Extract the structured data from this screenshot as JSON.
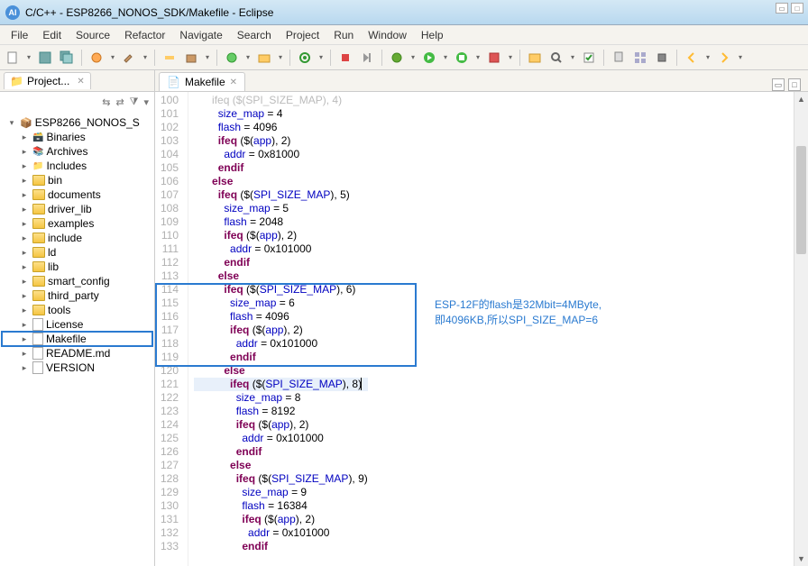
{
  "window": {
    "title": "C/C++ - ESP8266_NONOS_SDK/Makefile - Eclipse"
  },
  "menu": {
    "items": [
      "File",
      "Edit",
      "Source",
      "Refactor",
      "Navigate",
      "Search",
      "Project",
      "Run",
      "Window",
      "Help"
    ]
  },
  "sidebar": {
    "tab_label": "Project...",
    "root": "ESP8266_NONOS_S",
    "items": [
      {
        "label": "Binaries"
      },
      {
        "label": "Archives"
      },
      {
        "label": "Includes"
      },
      {
        "label": "bin"
      },
      {
        "label": "documents"
      },
      {
        "label": "driver_lib"
      },
      {
        "label": "examples"
      },
      {
        "label": "include"
      },
      {
        "label": "ld"
      },
      {
        "label": "lib"
      },
      {
        "label": "smart_config"
      },
      {
        "label": "third_party"
      },
      {
        "label": "tools"
      },
      {
        "label": "License"
      },
      {
        "label": "Makefile"
      },
      {
        "label": "README.md"
      },
      {
        "label": "VERSION"
      }
    ]
  },
  "editor": {
    "tab_label": "Makefile",
    "lines": [
      {
        "n": 100,
        "ind": 3,
        "raw": "ifeq ($(SPI_SIZE_MAP), 4)",
        "faded": true
      },
      {
        "n": 101,
        "ind": 4,
        "html": "<span class='var'>size_map</span> = 4"
      },
      {
        "n": 102,
        "ind": 4,
        "html": "<span class='var'>flash</span> = 4096"
      },
      {
        "n": 103,
        "ind": 4,
        "html": "<span class='kw'>ifeq</span> ($(<span class='var'>app</span>), 2)"
      },
      {
        "n": 104,
        "ind": 5,
        "html": "<span class='var'>addr</span> = 0x81000"
      },
      {
        "n": 105,
        "ind": 4,
        "html": "<span class='kw'>endif</span>"
      },
      {
        "n": 106,
        "ind": 3,
        "html": "<span class='kw'>else</span>"
      },
      {
        "n": 107,
        "ind": 4,
        "html": "<span class='kw'>ifeq</span> ($(<span class='var'>SPI_SIZE_MAP</span>), 5)"
      },
      {
        "n": 108,
        "ind": 5,
        "html": "<span class='var'>size_map</span> = 5"
      },
      {
        "n": 109,
        "ind": 5,
        "html": "<span class='var'>flash</span> = 2048"
      },
      {
        "n": 110,
        "ind": 5,
        "html": "<span class='kw'>ifeq</span> ($(<span class='var'>app</span>), 2)"
      },
      {
        "n": 111,
        "ind": 6,
        "html": "<span class='var'>addr</span> = 0x101000"
      },
      {
        "n": 112,
        "ind": 5,
        "html": "<span class='kw'>endif</span>"
      },
      {
        "n": 113,
        "ind": 4,
        "html": "<span class='kw'>else</span>"
      },
      {
        "n": 114,
        "ind": 5,
        "html": "<span class='kw'>ifeq</span> ($(<span class='var'>SPI_SIZE_MAP</span>), 6)"
      },
      {
        "n": 115,
        "ind": 6,
        "html": "<span class='var'>size_map</span> = 6"
      },
      {
        "n": 116,
        "ind": 6,
        "html": "<span class='var'>flash</span> = 4096"
      },
      {
        "n": 117,
        "ind": 6,
        "html": "<span class='kw'>ifeq</span> ($(<span class='var'>app</span>), 2)"
      },
      {
        "n": 118,
        "ind": 7,
        "html": "<span class='var'>addr</span> = 0x101000"
      },
      {
        "n": 119,
        "ind": 6,
        "html": "<span class='kw'>endif</span>"
      },
      {
        "n": 120,
        "ind": 5,
        "html": "<span class='kw'>else</span>"
      },
      {
        "n": 121,
        "ind": 6,
        "html": "<span class='kw'>ifeq</span> ($(<span class='var'>SPI_SIZE_MAP</span>), 8)<span class='cursor'></span>",
        "cl": true
      },
      {
        "n": 122,
        "ind": 7,
        "html": "<span class='var'>size_map</span> = 8"
      },
      {
        "n": 123,
        "ind": 7,
        "html": "<span class='var'>flash</span> = 8192"
      },
      {
        "n": 124,
        "ind": 7,
        "html": "<span class='kw'>ifeq</span> ($(<span class='var'>app</span>), 2)"
      },
      {
        "n": 125,
        "ind": 8,
        "html": "<span class='var'>addr</span> = 0x101000"
      },
      {
        "n": 126,
        "ind": 7,
        "html": "<span class='kw'>endif</span>"
      },
      {
        "n": 127,
        "ind": 6,
        "html": "<span class='kw'>else</span>"
      },
      {
        "n": 128,
        "ind": 7,
        "html": "<span class='kw'>ifeq</span> ($(<span class='var'>SPI_SIZE_MAP</span>), 9)"
      },
      {
        "n": 129,
        "ind": 8,
        "html": "<span class='var'>size_map</span> = 9"
      },
      {
        "n": 130,
        "ind": 8,
        "html": "<span class='var'>flash</span> = 16384"
      },
      {
        "n": 131,
        "ind": 8,
        "html": "<span class='kw'>ifeq</span> ($(<span class='var'>app</span>), 2)"
      },
      {
        "n": 132,
        "ind": 9,
        "html": "<span class='var'>addr</span> = 0x101000"
      },
      {
        "n": 133,
        "ind": 8,
        "html": "<span class='kw'>endif</span>"
      }
    ]
  },
  "annotation": {
    "line1": "ESP-12F的flash是32Mbit=4MByte,",
    "line2": "即4096KB,所以SPI_SIZE_MAP=6"
  }
}
